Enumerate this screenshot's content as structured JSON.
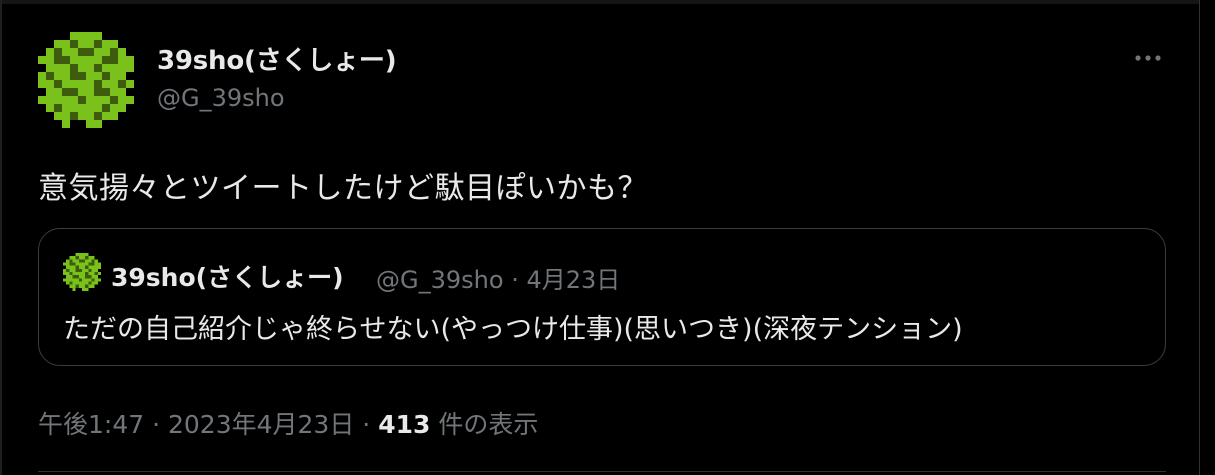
{
  "author": {
    "name": "39sho(さくしょー)",
    "handle": "@G_39sho",
    "avatar_icon": "turtle-pixel-avatar-icon"
  },
  "tweet": {
    "text": "意気揚々とツイートしたけど駄目ぽいかも？"
  },
  "quoted_tweet": {
    "name": "39sho(さくしょー)",
    "handle": "@G_39sho",
    "separator": "·",
    "date": "4月23日",
    "text": "ただの自己紹介じゃ終らせない(やっつけ仕事)(思いつき)(深夜テンション)"
  },
  "meta": {
    "time": "午後1:47",
    "separator": "·",
    "date": "2023年4月23日",
    "views_count": "413",
    "views_label": "件の表示"
  },
  "colors": {
    "background": "#000000",
    "text_primary": "#e7e9ea",
    "text_secondary": "#71767b",
    "border": "#3a3d40",
    "avatar_green": "#7ac21b",
    "avatar_dark": "#3d5d0c"
  },
  "menu": {
    "icon": "more-options-icon"
  }
}
